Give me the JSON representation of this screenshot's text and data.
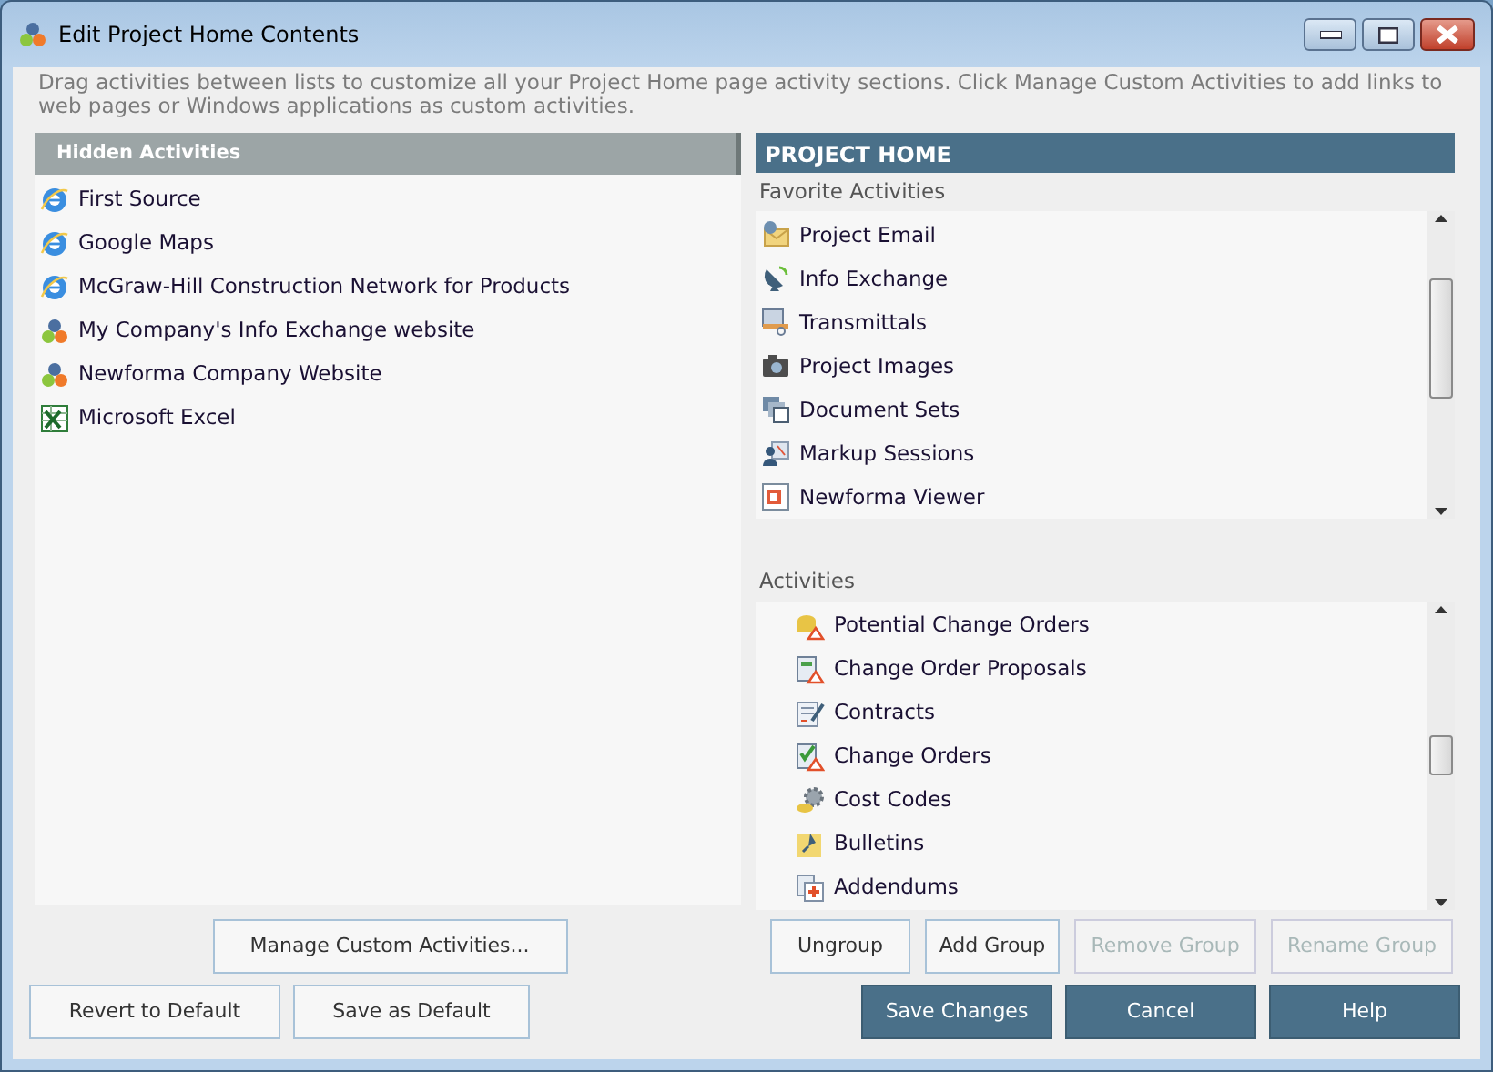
{
  "window": {
    "title": "Edit Project Home Contents"
  },
  "instructions": "Drag activities between lists to customize all your Project Home page activity sections.  Click Manage Custom Activities to add links to web pages or Windows applications as custom activities.",
  "hidden_activities": {
    "title": "Hidden Activities",
    "items": [
      {
        "label": "First Source",
        "kind": "browser"
      },
      {
        "label": "Google Maps",
        "kind": "browser"
      },
      {
        "label": "McGraw-Hill Construction Network for Products",
        "kind": "browser"
      },
      {
        "label": "My Company's Info Exchange website",
        "kind": "circles"
      },
      {
        "label": "Newforma Company Website",
        "kind": "circles"
      },
      {
        "label": "Microsoft Excel",
        "kind": "spreadsheet"
      }
    ]
  },
  "project_home": {
    "title": "PROJECT HOME",
    "favorites": {
      "title": "Favorite Activities",
      "items": [
        {
          "label": "Project Email",
          "kind": "envelope"
        },
        {
          "label": "Info Exchange",
          "kind": "dish"
        },
        {
          "label": "Transmittals",
          "kind": "tray"
        },
        {
          "label": "Project Images",
          "kind": "camera"
        },
        {
          "label": "Document Sets",
          "kind": "windows"
        },
        {
          "label": "Markup Sessions",
          "kind": "people"
        },
        {
          "label": "Newforma Viewer",
          "kind": "viewer"
        }
      ]
    },
    "activities": {
      "title": "Activities",
      "items": [
        {
          "label": "Potential Change Orders",
          "kind": "coins-warning"
        },
        {
          "label": "Change Order Proposals",
          "kind": "doc-warning"
        },
        {
          "label": "Contracts",
          "kind": "contract"
        },
        {
          "label": "Change Orders",
          "kind": "check-warning"
        },
        {
          "label": "Cost Codes",
          "kind": "gear"
        },
        {
          "label": "Bulletins",
          "kind": "note"
        },
        {
          "label": "Addendums",
          "kind": "doc-plus"
        }
      ]
    }
  },
  "buttons": [
    {
      "label": "Manage Custom Activities...",
      "kind": "plain",
      "disabled": false
    },
    {
      "label": "Ungroup",
      "kind": "plain",
      "disabled": false
    },
    {
      "label": "Add Group",
      "kind": "plain",
      "disabled": false
    },
    {
      "label": "Remove Group",
      "kind": "plain",
      "disabled": true
    },
    {
      "label": "Rename Group",
      "kind": "plain",
      "disabled": true
    },
    {
      "label": "Revert to Default",
      "kind": "plain",
      "disabled": false
    },
    {
      "label": "Save as Default",
      "kind": "plain",
      "disabled": false
    },
    {
      "label": "Save Changes",
      "kind": "primary",
      "disabled": false
    },
    {
      "label": "Cancel",
      "kind": "primary",
      "disabled": false
    },
    {
      "label": "Help",
      "kind": "primary",
      "disabled": false
    }
  ]
}
